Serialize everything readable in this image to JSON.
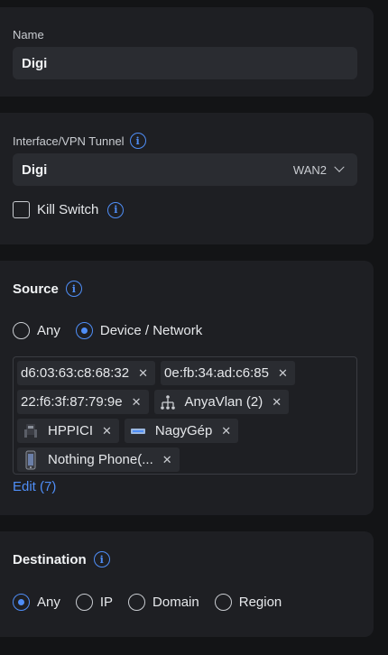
{
  "name_card": {
    "label": "Name",
    "value": "Digi"
  },
  "interface_card": {
    "label": "Interface/VPN Tunnel",
    "info_icon": "info-icon",
    "selected_value": "Digi",
    "selected_tag": "WAN2",
    "kill_switch_label": "Kill Switch"
  },
  "source_card": {
    "heading": "Source",
    "radios": [
      {
        "label": "Any",
        "selected": false
      },
      {
        "label": "Device / Network",
        "selected": true
      }
    ],
    "chips": [
      {
        "label": "d6:03:63:c8:68:32",
        "icon": null
      },
      {
        "label": "0e:fb:34:ad:c6:85",
        "icon": null
      },
      {
        "label": "22:f6:3f:87:79:9e",
        "icon": null
      },
      {
        "label": "AnyaVlan (2)",
        "icon": "network-topology-icon"
      },
      {
        "label": "HPPICI",
        "icon": "desktop-device-icon"
      },
      {
        "label": "NagyGép",
        "icon": "laptop-device-icon"
      },
      {
        "label": "Nothing Phone(...",
        "icon": "phone-device-icon"
      }
    ],
    "edit_label": "Edit (7)"
  },
  "destination_card": {
    "heading": "Destination",
    "radios": [
      {
        "label": "Any",
        "selected": true
      },
      {
        "label": "IP",
        "selected": false
      },
      {
        "label": "Domain",
        "selected": false
      },
      {
        "label": "Region",
        "selected": false
      }
    ]
  },
  "colors": {
    "accent": "#4f8ef7",
    "card_bg": "#1e1f23",
    "page_bg": "#131416"
  }
}
